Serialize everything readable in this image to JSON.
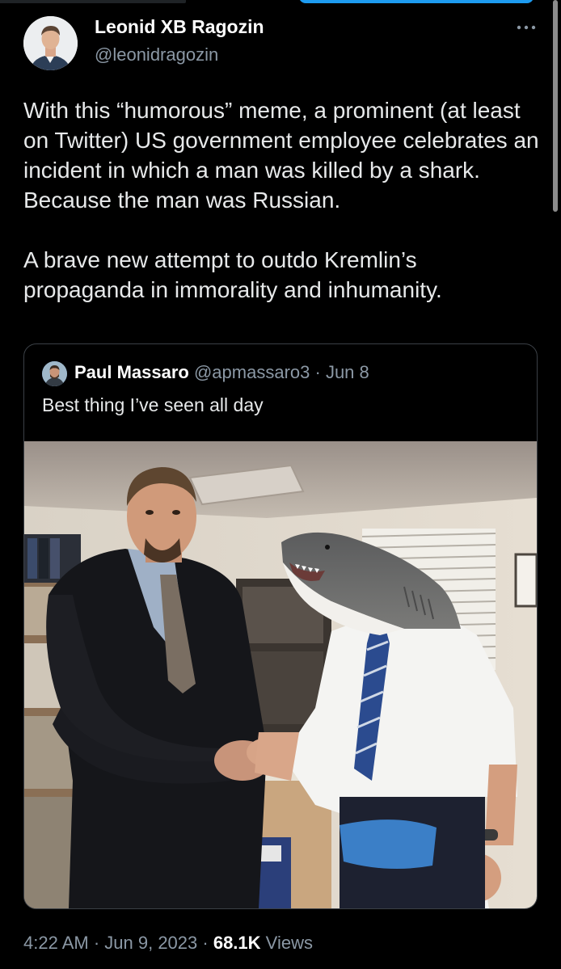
{
  "tweet": {
    "author_name": "Leonid XB Ragozin",
    "author_handle": "@leonidragozin",
    "more_icon": "more-horizontal-icon",
    "paragraphs": [
      "With this “humorous” meme, a prominent (at least on Twitter) US government employee celebrates an incident in which a man was killed by a shark. Because the man was Russian.",
      "A brave new attempt to outdo Kremlin’s propaganda in immorality and inhumanity."
    ],
    "time": "4:22 AM",
    "date": "Jun 9, 2023",
    "views_count": "68.1K",
    "views_label": "Views",
    "separator": " · "
  },
  "quote": {
    "author_name": "Paul Massaro",
    "author_handle": "@apmassaro3",
    "date": "Jun 8",
    "separator": " · ",
    "text": "Best thing I’ve seen all day"
  },
  "colors": {
    "background": "#000000",
    "text_primary": "#e7e9ea",
    "text_secondary": "#8b98a5",
    "border": "#3b4046",
    "accent": "#1d9bf0"
  }
}
